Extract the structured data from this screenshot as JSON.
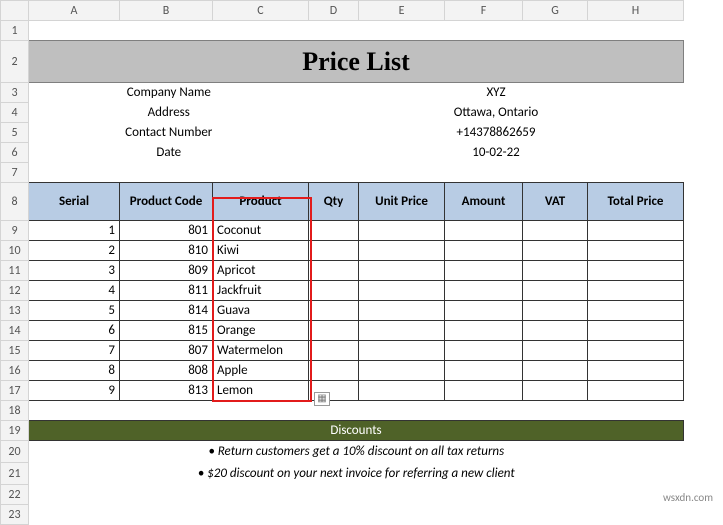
{
  "columns": [
    "",
    "A",
    "B",
    "C",
    "D",
    "E",
    "F",
    "G",
    "H"
  ],
  "rows": [
    "1",
    "2",
    "3",
    "4",
    "5",
    "6",
    "7",
    "8",
    "9",
    "10",
    "11",
    "12",
    "13",
    "14",
    "15",
    "16",
    "17",
    "18",
    "19",
    "20",
    "21",
    "22",
    "23"
  ],
  "title": "Price List",
  "company": {
    "name_label": "Company Name",
    "name_value": "XYZ",
    "address_label": "Address",
    "address_value": "Ottawa, Ontario",
    "contact_label": "Contact Number",
    "contact_value": "+14378862659",
    "date_label": "Date",
    "date_value": "10-02-22"
  },
  "headers": {
    "serial": "Serial",
    "code": "Product Code",
    "product": "Product",
    "qty": "Qty",
    "unit": "Unit Price",
    "amount": "Amount",
    "vat": "VAT",
    "total": "Total Price"
  },
  "data": [
    {
      "serial": "1",
      "code": "801",
      "product": "Coconut"
    },
    {
      "serial": "2",
      "code": "810",
      "product": "Kiwi"
    },
    {
      "serial": "3",
      "code": "809",
      "product": "Apricot"
    },
    {
      "serial": "4",
      "code": "811",
      "product": "Jackfruit"
    },
    {
      "serial": "5",
      "code": "814",
      "product": "Guava"
    },
    {
      "serial": "6",
      "code": "815",
      "product": "Orange"
    },
    {
      "serial": "7",
      "code": "807",
      "product": "Watermelon"
    },
    {
      "serial": "8",
      "code": "808",
      "product": "Apple"
    },
    {
      "serial": "9",
      "code": "813",
      "product": "Lemon"
    }
  ],
  "discounts": {
    "header": "Discounts",
    "line1": "• Return customers get a 10% discount on all tax returns",
    "line2": "• $20 discount on your next invoice for referring a new client"
  },
  "watermark": "wsxdn.com",
  "chart_data": {
    "type": "table",
    "columns": [
      "Serial",
      "Product Code",
      "Product",
      "Qty",
      "Unit Price",
      "Amount",
      "VAT",
      "Total Price"
    ],
    "rows": [
      [
        1,
        801,
        "Coconut",
        null,
        null,
        null,
        null,
        null
      ],
      [
        2,
        810,
        "Kiwi",
        null,
        null,
        null,
        null,
        null
      ],
      [
        3,
        809,
        "Apricot",
        null,
        null,
        null,
        null,
        null
      ],
      [
        4,
        811,
        "Jackfruit",
        null,
        null,
        null,
        null,
        null
      ],
      [
        5,
        814,
        "Guava",
        null,
        null,
        null,
        null,
        null
      ],
      [
        6,
        815,
        "Orange",
        null,
        null,
        null,
        null,
        null
      ],
      [
        7,
        807,
        "Watermelon",
        null,
        null,
        null,
        null,
        null
      ],
      [
        8,
        808,
        "Apple",
        null,
        null,
        null,
        null,
        null
      ],
      [
        9,
        813,
        "Lemon",
        null,
        null,
        null,
        null,
        null
      ]
    ],
    "title": "Price List"
  },
  "col_widths": {
    "rh": 28,
    "A": 91,
    "B": 93,
    "C": 96,
    "D": 50,
    "E": 86,
    "F": 78,
    "G": 65,
    "H": 96
  }
}
